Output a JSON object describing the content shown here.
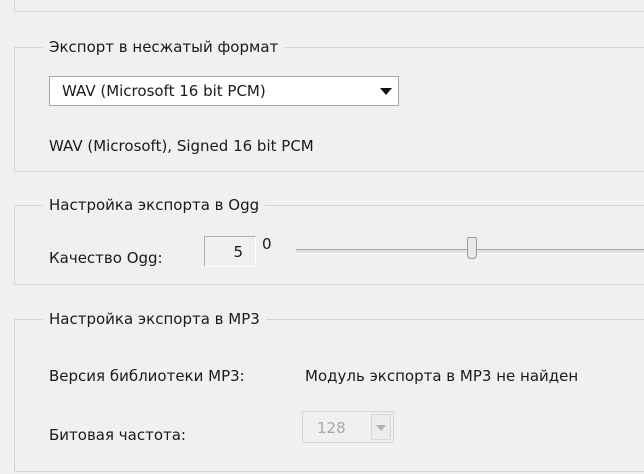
{
  "wav_export": {
    "legend": "Экспорт в несжатый формат",
    "format_select": {
      "value": "WAV (Microsoft 16 bit PCM)"
    },
    "description": "WAV (Microsoft), Signed 16 bit PCM"
  },
  "ogg_export": {
    "legend": "Настройка экспорта в Ogg",
    "quality_label": "Качество Ogg:",
    "quality_value": "5",
    "slider_min_label": "0",
    "slider_level_fraction": 0.5
  },
  "mp3_export": {
    "legend": "Настройка экспорта в MP3",
    "library_version_label": "Версия библиотеки MP3:",
    "library_version_status": "Модуль экспорта в MP3 не найден",
    "bitrate_label": "Битовая частота:",
    "bitrate_value": "128",
    "bitrate_enabled": false
  }
}
